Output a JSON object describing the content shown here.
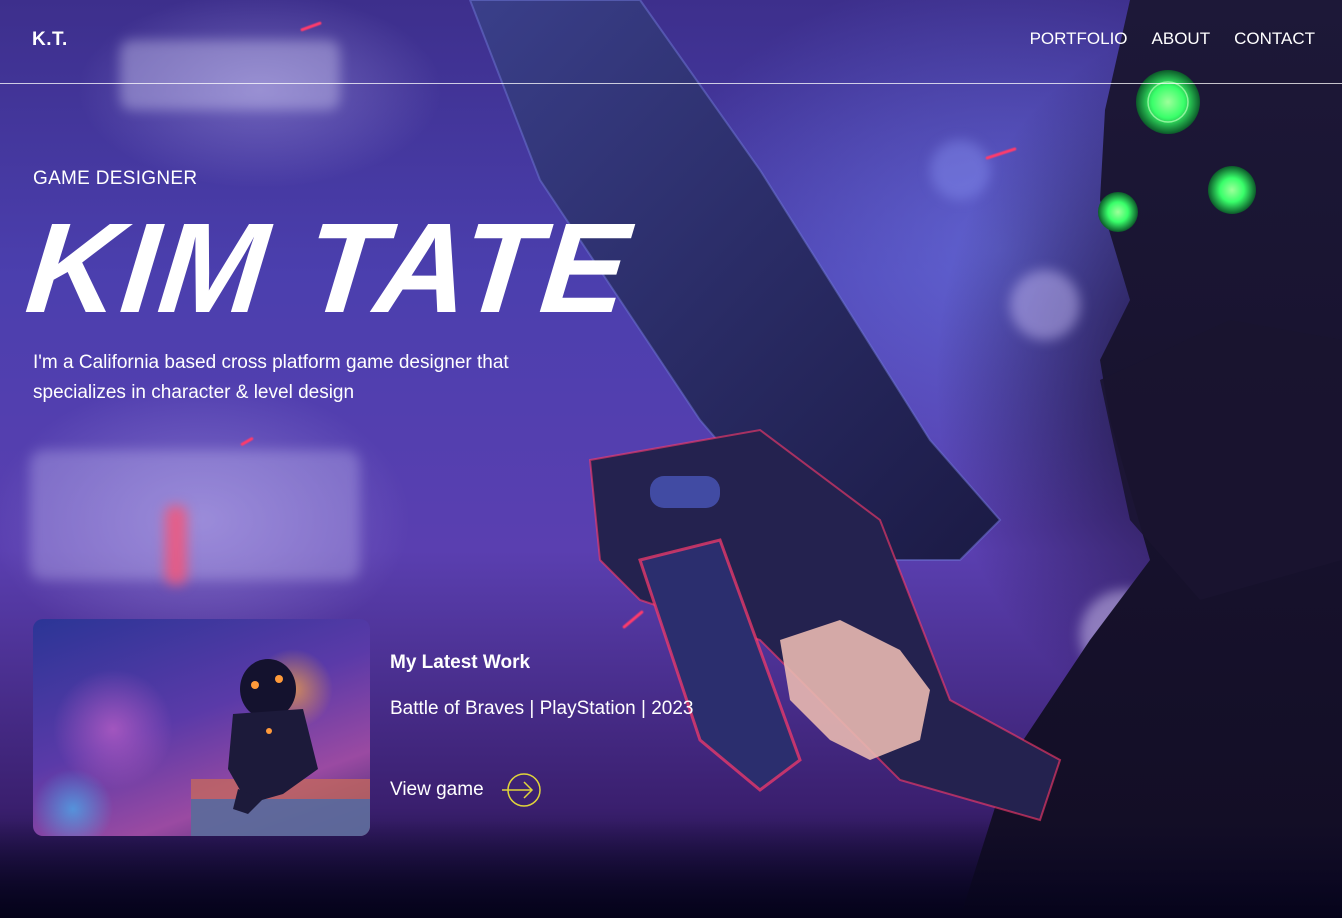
{
  "header": {
    "logo": "K.T.",
    "nav": [
      "PORTFOLIO",
      "ABOUT",
      "CONTACT"
    ]
  },
  "hero": {
    "eyebrow": "GAME DESIGNER",
    "name": "KIM TATE",
    "tagline": "I'm a California based cross platform game designer that specializes in character & level design"
  },
  "latest_work": {
    "title": "My Latest Work",
    "meta": "Battle of Braves | PlayStation | 2023",
    "link_label": "View game",
    "link_icon": "arrow-right-circle-icon"
  },
  "colors": {
    "accent": "#e0d43a",
    "spark": "#ff3b6b",
    "visor": "#39ff6a"
  }
}
